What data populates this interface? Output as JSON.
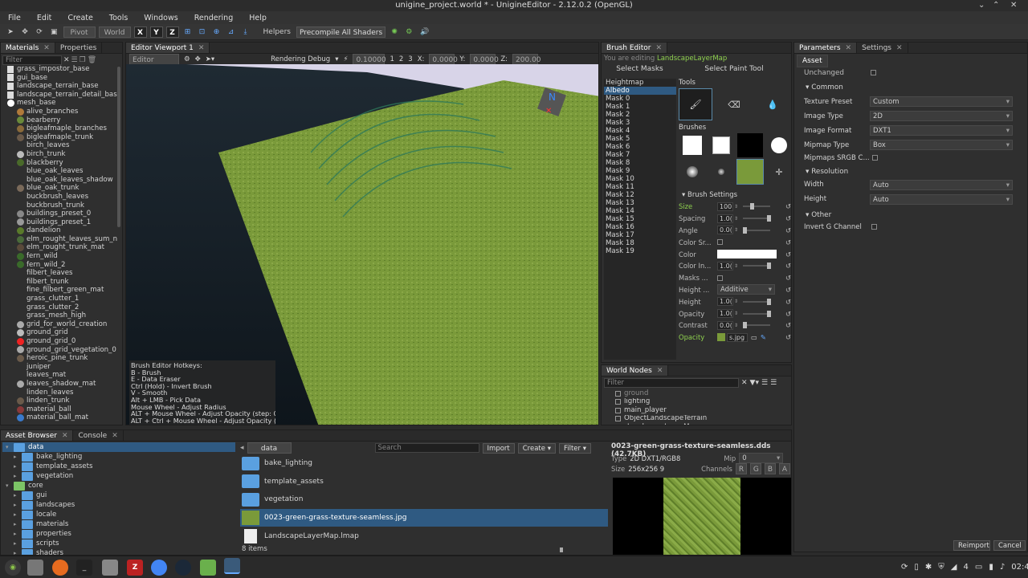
{
  "window": {
    "title": "unigine_project.world * - UnigineEditor - 2.12.0.2 (OpenGL)"
  },
  "menu": [
    "File",
    "Edit",
    "Create",
    "Tools",
    "Windows",
    "Rendering",
    "Help"
  ],
  "toolbar": {
    "pivot": "Pivot",
    "world": "World",
    "axes": [
      "X",
      "Y",
      "Z"
    ],
    "helpers": "Helpers",
    "precompile": "Precompile All Shaders"
  },
  "materials_panel": {
    "tabs": [
      "Materials",
      "Properties"
    ],
    "items": [
      {
        "label": "grass_impostor_base",
        "icon": "doc",
        "indent": 1
      },
      {
        "label": "gui_base",
        "icon": "doc",
        "indent": 1
      },
      {
        "label": "landscape_terrain_base",
        "icon": "doc",
        "indent": 1
      },
      {
        "label": "landscape_terrain_detail_bas",
        "icon": "doc",
        "indent": 1
      },
      {
        "label": "mesh_base",
        "icon": "white",
        "indent": 1
      },
      {
        "label": "alive_branches",
        "icon": "#b07a3a",
        "indent": 2
      },
      {
        "label": "bearberry",
        "icon": "#6a8a3a",
        "indent": 2
      },
      {
        "label": "bigleafmaple_branches",
        "icon": "#8a6a3a",
        "indent": 2
      },
      {
        "label": "bigleafmaple_trunk",
        "icon": "#6a5a4a",
        "indent": 2
      },
      {
        "label": "birch_leaves",
        "icon": "none",
        "indent": 2
      },
      {
        "label": "birch_trunk",
        "icon": "#bbbbbb",
        "indent": 2
      },
      {
        "label": "blackberry",
        "icon": "#4a6a2a",
        "indent": 2
      },
      {
        "label": "blue_oak_leaves",
        "icon": "none",
        "indent": 2
      },
      {
        "label": "blue_oak_leaves_shadow",
        "icon": "none",
        "indent": 2
      },
      {
        "label": "blue_oak_trunk",
        "icon": "#7a6a5a",
        "indent": 2
      },
      {
        "label": "buckbrush_leaves",
        "icon": "none",
        "indent": 2
      },
      {
        "label": "buckbrush_trunk",
        "icon": "none",
        "indent": 2
      },
      {
        "label": "buildings_preset_0",
        "icon": "#888888",
        "indent": 2
      },
      {
        "label": "buildings_preset_1",
        "icon": "#999999",
        "indent": 2
      },
      {
        "label": "dandelion",
        "icon": "#5a7a2a",
        "indent": 2
      },
      {
        "label": "elm_rought_leaves_sum_n",
        "icon": "#4a6a3a",
        "indent": 2
      },
      {
        "label": "elm_rought_trunk_mat",
        "icon": "#5a4a3a",
        "indent": 2
      },
      {
        "label": "fern_wild",
        "icon": "#3a6a2a",
        "indent": 2
      },
      {
        "label": "fern_wild_2",
        "icon": "#3a6a2a",
        "indent": 2
      },
      {
        "label": "filbert_leaves",
        "icon": "none",
        "indent": 2
      },
      {
        "label": "filbert_trunk",
        "icon": "none",
        "indent": 2
      },
      {
        "label": "fine_filbert_green_mat",
        "icon": "none",
        "indent": 2
      },
      {
        "label": "grass_clutter_1",
        "icon": "none",
        "indent": 2
      },
      {
        "label": "grass_clutter_2",
        "icon": "none",
        "indent": 2
      },
      {
        "label": "grass_mesh_high",
        "icon": "none",
        "indent": 2
      },
      {
        "label": "grid_for_world_creation",
        "icon": "#aaaaaa",
        "indent": 2
      },
      {
        "label": "ground_grid",
        "icon": "#bbbbbb",
        "indent": 2
      },
      {
        "label": "ground_grid_0",
        "icon": "#ee2222",
        "indent": 2
      },
      {
        "label": "ground_grid_vegetation_0",
        "icon": "#aaaaaa",
        "indent": 2
      },
      {
        "label": "heroic_pine_trunk",
        "icon": "#6a5a4a",
        "indent": 2
      },
      {
        "label": "juniper",
        "icon": "none",
        "indent": 2
      },
      {
        "label": "leaves_mat",
        "icon": "none",
        "indent": 2
      },
      {
        "label": "leaves_shadow_mat",
        "icon": "#aaaaaa",
        "indent": 2
      },
      {
        "label": "linden_leaves",
        "icon": "none",
        "indent": 2
      },
      {
        "label": "linden_trunk",
        "icon": "#6a5a4a",
        "indent": 2
      },
      {
        "label": "material_ball",
        "icon": "#8a3a3a",
        "indent": 2
      },
      {
        "label": "material_ball_mat",
        "icon": "#3a7acc",
        "indent": 2
      }
    ]
  },
  "viewport": {
    "tab": "Editor Viewport 1",
    "camera": "Editor Camera",
    "rendering_debug": "Rendering Debug",
    "speed": "0.10000",
    "nums": [
      "1",
      "2",
      "3"
    ],
    "x_label": "X:",
    "x_val": "0.0000",
    "y_label": "Y:",
    "y_val": "0.0000",
    "z_label": "Z:",
    "z_val": "200.00",
    "hotkeys": [
      "Brush Editor Hotkeys:",
      "B - Brush",
      "E - Data Eraser",
      "Ctrl (Hold) - Invert Brush",
      "V - Smooth",
      "Alt + LMB - Pick Data",
      "Mouse Wheel - Adjust Radius",
      "ALT + Mouse Wheel -  Adjust Opacity (step: 0",
      "ALT + Ctrl + Mouse Wheel - Adjust Opacity ("
    ]
  },
  "brush_editor": {
    "tab": "Brush Editor",
    "editing_prefix": "You are editing",
    "editing_target": "LandscapeLayerMap",
    "select_masks": "Select Masks",
    "select_paint_tool": "Select Paint Tool",
    "masks": [
      "Heightmap",
      "Albedo",
      "Mask 0",
      "Mask 1",
      "Mask 2",
      "Mask 3",
      "Mask 4",
      "Mask 5",
      "Mask 6",
      "Mask 7",
      "Mask 8",
      "Mask 9",
      "Mask 10",
      "Mask 11",
      "Mask 12",
      "Mask 13",
      "Mask 14",
      "Mask 15",
      "Mask 16",
      "Mask 17",
      "Mask 18",
      "Mask 19"
    ],
    "selected_mask": "Albedo",
    "tools_label": "Tools",
    "brushes_label": "Brushes",
    "brush_settings_label": "Brush Settings",
    "settings": [
      {
        "label": "Size",
        "value": "100",
        "highlight": true,
        "level": 0.3
      },
      {
        "label": "Spacing",
        "value": "1.0(",
        "level": 1.0
      },
      {
        "label": "Angle",
        "value": "0.0(",
        "level": 0.0
      },
      {
        "label": "Color Sr...",
        "value": "",
        "type": "check"
      },
      {
        "label": "Color",
        "value": "",
        "type": "color"
      },
      {
        "label": "Color In...",
        "value": "1.0(",
        "level": 1.0
      },
      {
        "label": "Masks ...",
        "value": "",
        "type": "check"
      },
      {
        "label": "Height ...",
        "value": "Additive",
        "type": "select"
      },
      {
        "label": "Height",
        "value": "1.0(",
        "level": 1.0
      },
      {
        "label": "Opacity",
        "value": "1.0(",
        "level": 1.0
      },
      {
        "label": "Contrast",
        "value": "0.0(",
        "level": 0.0
      },
      {
        "label": "Opacity",
        "value": "s.jpg",
        "highlight": true,
        "type": "file"
      }
    ]
  },
  "world_nodes": {
    "tab": "World Nodes",
    "filter_placeholder": "Filter",
    "items": [
      {
        "label": "ground",
        "indent": 1
      },
      {
        "label": "lighting",
        "indent": 1
      },
      {
        "label": "main_player",
        "indent": 1
      },
      {
        "label": "ObjectLandscapeTerrain",
        "indent": 1
      },
      {
        "label": "LandscapeLayerMap",
        "indent": 2
      }
    ]
  },
  "parameters": {
    "tabs": [
      "Parameters",
      "Settings"
    ],
    "subtab": "Asset",
    "unchanged": "Unchanged",
    "common": "Common",
    "fields": [
      {
        "label": "Texture Preset",
        "value": "Custom"
      },
      {
        "label": "Image Type",
        "value": "2D"
      },
      {
        "label": "Image Format",
        "value": "DXT1"
      },
      {
        "label": "Mipmap Type",
        "value": "Box"
      }
    ],
    "mipmaps_srgb": "Mipmaps SRGB C...",
    "resolution": "Resolution",
    "width_label": "Width",
    "width_value": "Auto",
    "height_label": "Height",
    "height_value": "Auto",
    "other": "Other",
    "invert_g": "Invert G Channel",
    "reimport": "Reimport",
    "cancel": "Cancel"
  },
  "asset_browser": {
    "tabs": [
      "Asset Browser",
      "Console"
    ],
    "tree": [
      {
        "label": "data",
        "indent": 0,
        "selected": true
      },
      {
        "label": "bake_lighting",
        "indent": 1
      },
      {
        "label": "template_assets",
        "indent": 1
      },
      {
        "label": "vegetation",
        "indent": 1
      },
      {
        "label": "core",
        "indent": 0
      },
      {
        "label": "gui",
        "indent": 1
      },
      {
        "label": "landscapes",
        "indent": 1
      },
      {
        "label": "locale",
        "indent": 1
      },
      {
        "label": "materials",
        "indent": 1
      },
      {
        "label": "properties",
        "indent": 1
      },
      {
        "label": "scripts",
        "indent": 1
      },
      {
        "label": "shaders",
        "indent": 1
      }
    ],
    "path": "data",
    "search_placeholder": "Search",
    "import": "Import",
    "create": "Create",
    "filter": "Filter",
    "files": [
      {
        "label": "bake_lighting",
        "kind": "folder"
      },
      {
        "label": "template_assets",
        "kind": "folder"
      },
      {
        "label": "vegetation",
        "kind": "folder"
      },
      {
        "label": "0023-green-grass-texture-seamless.jpg",
        "kind": "image",
        "selected": true
      },
      {
        "label": "LandscapeLayerMap.lmap",
        "kind": "file"
      }
    ],
    "count": "8 items"
  },
  "preview": {
    "title": "0023-green-grass-texture-seamless.dds (42.7KB)",
    "type_label": "Type",
    "type_value": "2D DXT1/RGB8",
    "mip_label": "Mip",
    "mip_value": "0",
    "size_label": "Size",
    "size_value": "256x256 9",
    "channels_label": "Channels",
    "channels": [
      "R",
      "G",
      "B",
      "A"
    ]
  },
  "taskbar": {
    "clock": "02:46",
    "workspace": "4"
  }
}
